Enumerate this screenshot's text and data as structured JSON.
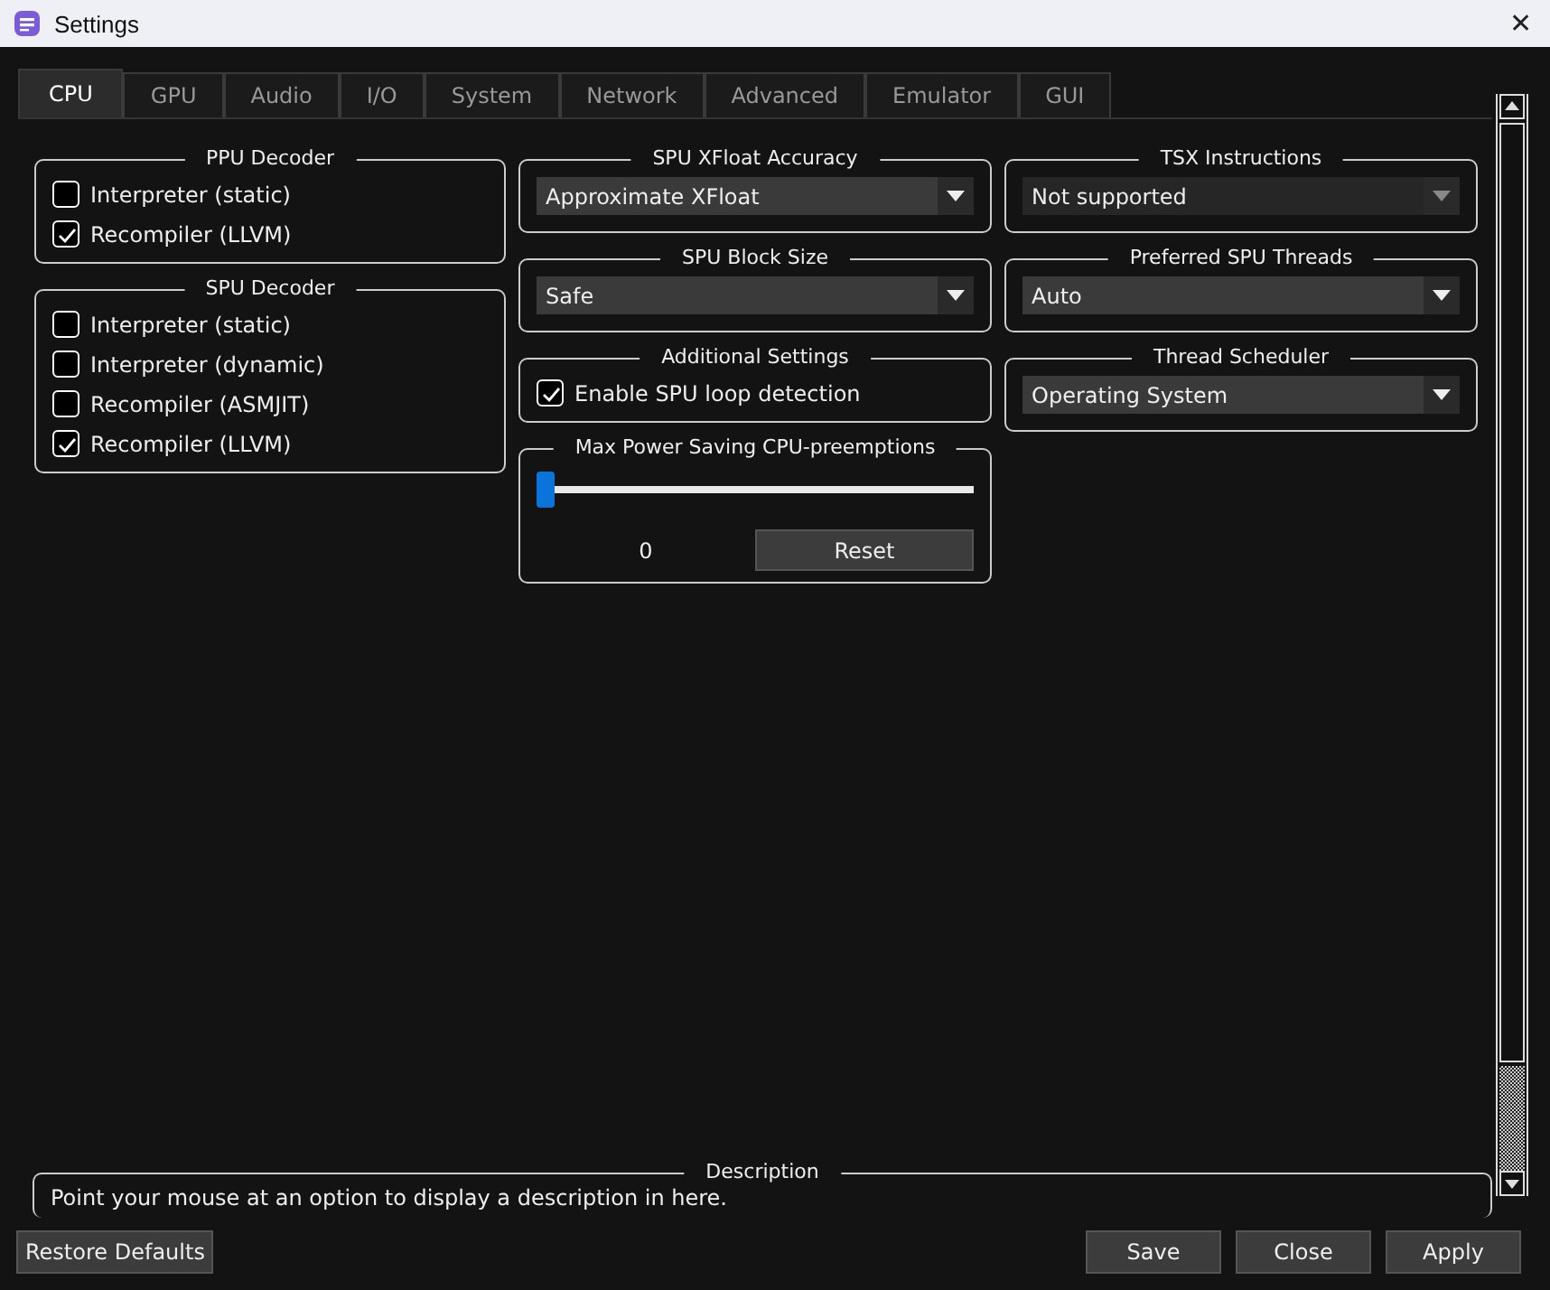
{
  "window": {
    "title": "Settings",
    "close": "✕"
  },
  "tabs": [
    {
      "label": "CPU",
      "selected": true
    },
    {
      "label": "GPU",
      "selected": false
    },
    {
      "label": "Audio",
      "selected": false
    },
    {
      "label": "I/O",
      "selected": false
    },
    {
      "label": "System",
      "selected": false
    },
    {
      "label": "Network",
      "selected": false
    },
    {
      "label": "Advanced",
      "selected": false
    },
    {
      "label": "Emulator",
      "selected": false
    },
    {
      "label": "GUI",
      "selected": false
    }
  ],
  "columns": [
    [
      {
        "kind": "checks",
        "title": "PPU Decoder",
        "items": [
          {
            "label": "Interpreter (static)",
            "checked": false
          },
          {
            "label": "Recompiler (LLVM)",
            "checked": true
          }
        ]
      },
      {
        "kind": "checks",
        "title": "SPU Decoder",
        "items": [
          {
            "label": "Interpreter (static)",
            "checked": false
          },
          {
            "label": "Interpreter (dynamic)",
            "checked": false
          },
          {
            "label": "Recompiler (ASMJIT)",
            "checked": false
          },
          {
            "label": "Recompiler (LLVM)",
            "checked": true
          }
        ]
      }
    ],
    [
      {
        "kind": "dropdown",
        "title": "SPU XFloat Accuracy",
        "value": "Approximate XFloat",
        "disabled": false
      },
      {
        "kind": "dropdown",
        "title": "SPU Block Size",
        "value": "Safe",
        "disabled": false
      },
      {
        "kind": "checks",
        "title": "Additional Settings",
        "items": [
          {
            "label": "Enable SPU loop detection",
            "checked": true
          }
        ]
      },
      {
        "kind": "slider",
        "title": "Max Power Saving CPU-preemptions",
        "level": 0,
        "reading": "0",
        "button": "Reset"
      }
    ],
    [
      {
        "kind": "dropdown",
        "title": "TSX Instructions",
        "value": "Not supported",
        "disabled": true
      },
      {
        "kind": "dropdown",
        "title": "Preferred SPU Threads",
        "value": "Auto",
        "disabled": false
      },
      {
        "kind": "dropdown",
        "title": "Thread Scheduler",
        "value": "Operating System",
        "disabled": false
      }
    ]
  ],
  "description": {
    "title": "Description",
    "text": "Point your mouse at an option to display a description in here."
  },
  "buttons": {
    "restore": "Restore Defaults",
    "actions": [
      "Save",
      "Close",
      "Apply"
    ]
  }
}
